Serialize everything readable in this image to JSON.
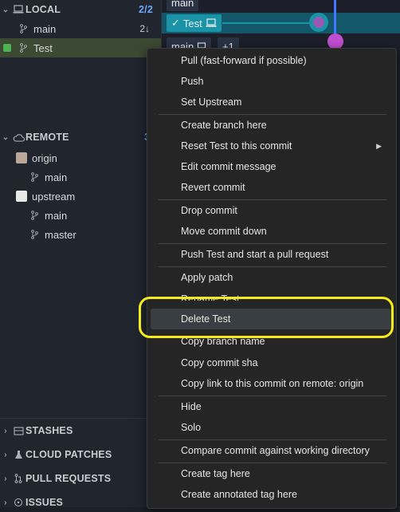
{
  "sidebar": {
    "local": {
      "label": "LOCAL",
      "count": "2/2",
      "branches": [
        {
          "name": "main",
          "badge": "2↓"
        },
        {
          "name": "Test",
          "badge": ""
        }
      ]
    },
    "remote": {
      "label": "REMOTE",
      "count": "3/",
      "remotes": [
        {
          "name": "origin",
          "branches": [
            "main"
          ]
        },
        {
          "name": "upstream",
          "branches": [
            "main",
            "master"
          ]
        }
      ]
    },
    "bottom_sections": [
      {
        "label": "STASHES",
        "icon": "archive-icon"
      },
      {
        "label": "CLOUD PATCHES",
        "icon": "flask-icon"
      },
      {
        "label": "PULL REQUESTS",
        "icon": "pull-request-icon"
      },
      {
        "label": "ISSUES",
        "icon": "issue-icon"
      }
    ]
  },
  "graph": {
    "pills": [
      {
        "label": "main"
      },
      {
        "label": "Test",
        "check": "✓"
      },
      {
        "label": "main"
      },
      {
        "label": "+1"
      }
    ],
    "colors": {
      "test_branch": "#1a93a6",
      "main_lane": "#3d78ff"
    }
  },
  "menu": {
    "items": [
      {
        "label": "Pull (fast-forward if possible)"
      },
      {
        "label": "Push"
      },
      {
        "label": "Set Upstream"
      },
      {
        "label": "Create branch here"
      },
      {
        "label": "Reset Test to this commit",
        "submenu": "▶"
      },
      {
        "label": "Edit commit message"
      },
      {
        "label": "Revert commit"
      },
      {
        "label": "Drop commit"
      },
      {
        "label": "Move commit down"
      },
      {
        "label": "Push Test and start a pull request"
      },
      {
        "label": "Apply patch"
      },
      {
        "label": "Rename Test"
      },
      {
        "label": "Delete Test"
      },
      {
        "label": "Copy branch name"
      },
      {
        "label": "Copy commit sha"
      },
      {
        "label": "Copy link to this commit on remote: origin"
      },
      {
        "label": "Hide"
      },
      {
        "label": "Solo"
      },
      {
        "label": "Compare commit against working directory"
      },
      {
        "label": "Create tag here"
      },
      {
        "label": "Create annotated tag here"
      }
    ]
  },
  "highlight_color": "#f7ec1b"
}
